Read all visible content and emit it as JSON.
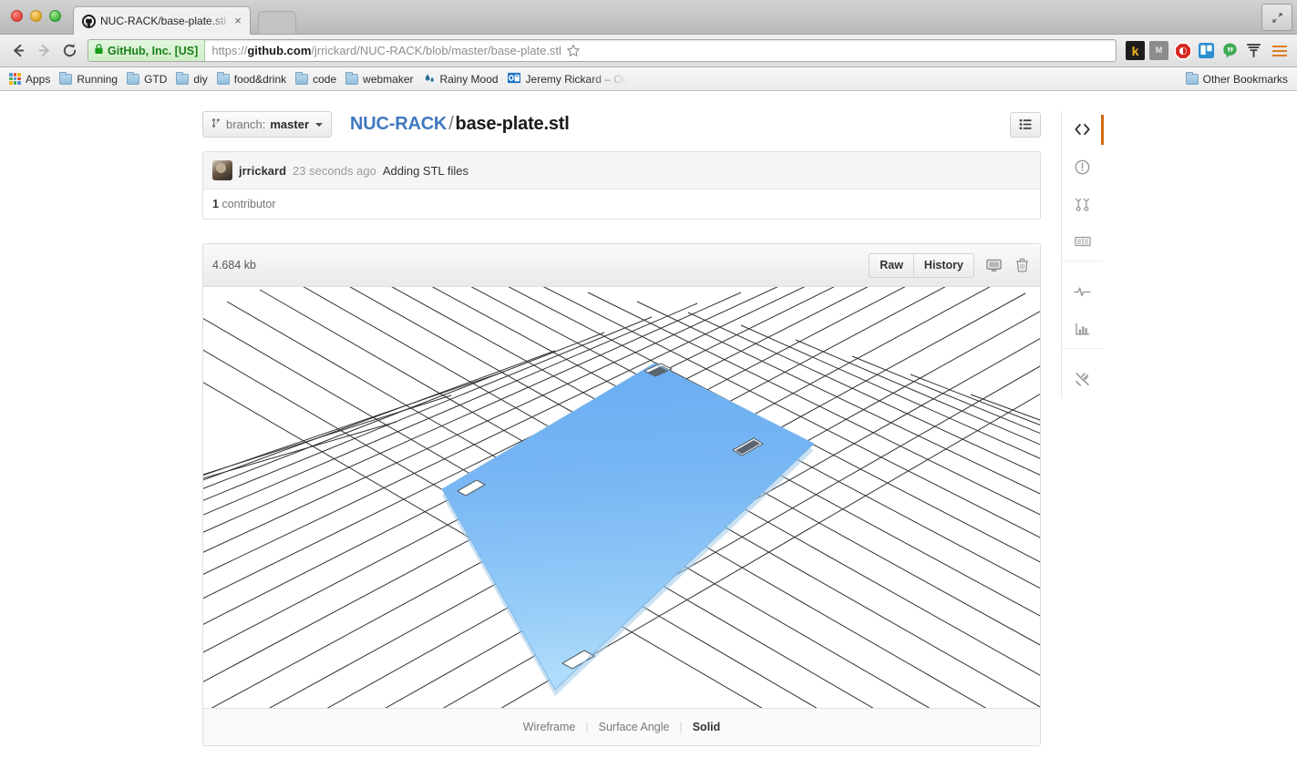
{
  "browser": {
    "tab": {
      "title": "NUC-RACK/base-plate.stl",
      "favicon": "github-mark-icon",
      "close": "×"
    },
    "nav": {
      "back": "back-icon",
      "forward": "forward-icon",
      "reload": "reload-icon"
    },
    "omnibox": {
      "ev_badge": "GitHub, Inc. [US]",
      "url_scheme": "https://",
      "url_host": "github.com",
      "url_path": "/jrrickard/NUC-RACK/blob/master/base-plate.stl",
      "url_full": "https://github.com/jrrickard/NUC-RACK/blob/master/base-plate.stl",
      "star": "bookmark-star-icon",
      "lock": "lock-icon"
    },
    "extensions": [
      {
        "name": "kippt-extension-icon",
        "label": "k"
      },
      {
        "name": "mailto-extension-icon",
        "label": "M"
      },
      {
        "name": "adblock-extension-icon",
        "label": ""
      },
      {
        "name": "trello-extension-icon",
        "label": ""
      },
      {
        "name": "hangouts-extension-icon",
        "label": ""
      },
      {
        "name": "fork-extension-icon",
        "label": ""
      }
    ],
    "menu": "chrome-menu-icon",
    "maximize": "fullscreen-icon",
    "bookmarks": {
      "apps": "Apps",
      "items": [
        {
          "label": "Running",
          "icon": "folder-icon"
        },
        {
          "label": "GTD",
          "icon": "folder-icon"
        },
        {
          "label": "diy",
          "icon": "folder-icon"
        },
        {
          "label": "food&drink",
          "icon": "folder-icon"
        },
        {
          "label": "code",
          "icon": "folder-icon"
        },
        {
          "label": "webmaker",
          "icon": "folder-icon"
        },
        {
          "label": "Rainy Mood",
          "icon": "rainy-mood-icon"
        },
        {
          "label": "Jeremy Rickard – Ou",
          "icon": "outlook-icon"
        }
      ],
      "other": {
        "label": "Other Bookmarks",
        "icon": "folder-icon"
      }
    }
  },
  "page": {
    "branch": {
      "prefix": "branch:",
      "name": "master",
      "icon": "branch-icon"
    },
    "breadcrumb": {
      "repo": "NUC-RACK",
      "separator": "/",
      "file": "base-plate.stl"
    },
    "list_toggle": "file-list-icon",
    "commit": {
      "author": "jrrickard",
      "time": "23 seconds ago",
      "message": "Adding STL files",
      "avatar": "user-avatar"
    },
    "contributors": {
      "count": "1",
      "label": "contributor"
    },
    "blob": {
      "size": "4.684 kb",
      "raw": "Raw",
      "history": "History",
      "desktop_icon": "open-in-desktop-icon",
      "delete_icon": "trash-icon"
    },
    "render_modes": [
      {
        "label": "Wireframe",
        "active": false
      },
      {
        "label": "Surface Angle",
        "active": false
      },
      {
        "label": "Solid",
        "active": true
      }
    ],
    "render_separator": "|",
    "rail": [
      {
        "name": "code",
        "icon": "code-icon",
        "active": true
      },
      {
        "name": "issues",
        "icon": "issue-opened-icon",
        "active": false
      },
      {
        "name": "pull-requests",
        "icon": "git-pull-request-icon",
        "active": false
      },
      {
        "name": "wiki",
        "icon": "book-icon",
        "active": false
      },
      {
        "name": "pulse",
        "icon": "pulse-icon",
        "active": false
      },
      {
        "name": "graphs",
        "icon": "graph-icon",
        "active": false
      },
      {
        "name": "settings",
        "icon": "tools-icon",
        "active": false
      }
    ],
    "model": {
      "name": "base-plate.stl",
      "fill_top": "#74b3f3",
      "fill_bottom": "#a9d7f8",
      "edge_color": "#5b6570",
      "grid_color": "#2a2a2a",
      "background": "#ffffff"
    }
  }
}
